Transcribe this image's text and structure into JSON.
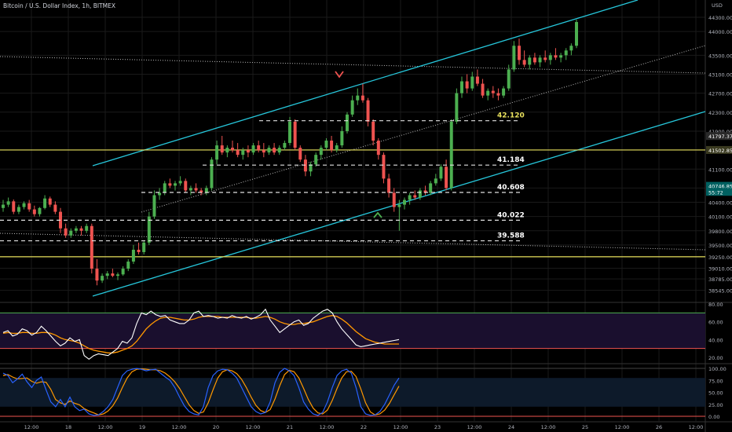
{
  "header": {
    "symbol_text": "Bitcoin / U.S. Dollar Index, 1h, BITMEX"
  },
  "colors": {
    "bg": "#000000",
    "grid": "#1a1a1a",
    "up": "#4caf50",
    "down": "#ef5350",
    "channel": "#26c6da",
    "yellow": "#e8e05c",
    "dashed": "#e0e0e0",
    "rsi_line": "#ffffff",
    "rsi_ma": "#ff9800",
    "rsi_band": "#1a0f2e",
    "rsi_upper": "#4caf50",
    "rsi_lower": "#ef5350",
    "stoch_k": "#2962ff",
    "stoch_d": "#ff9800",
    "stoch_band": "#0d1a2a",
    "last_price_bg": "#006060"
  },
  "chart_data": [
    {
      "type": "candlestick",
      "currency": "USD",
      "ylim": [
        38450,
        44400
      ],
      "y_ticks": [
        "44300.00",
        "44000.00",
        "43500.00",
        "43100.00",
        "42700.00",
        "42300.00",
        "41900.00",
        "41500.00",
        "41100.00",
        "40700.00",
        "40400.00",
        "40100.00",
        "39800.00",
        "39500.00",
        "39250.00",
        "39010.00",
        "38785.00",
        "38545.00"
      ],
      "x_ticks": [
        "12:00",
        "18",
        "12:00",
        "19",
        "12:00",
        "20",
        "12:00",
        "21",
        "12:00",
        "22",
        "12:00",
        "23",
        "12:00",
        "24",
        "12:00",
        "25",
        "12:00",
        "26",
        "12:00"
      ],
      "levels": [
        {
          "label": "42.120",
          "value": 42120,
          "style": "dashed",
          "label_color": "#e8e05c"
        },
        {
          "label": "41.184",
          "value": 41184,
          "style": "dashed",
          "label_color": "#ffffff"
        },
        {
          "label": "40.608",
          "value": 40608,
          "style": "dashed",
          "label_color": "#ffffff"
        },
        {
          "label": "40.022",
          "value": 40022,
          "style": "dashed",
          "label_color": "#ffffff"
        },
        {
          "label": "39.588",
          "value": 39588,
          "style": "dashed",
          "label_color": "#ffffff"
        }
      ],
      "horizontal_lines": [
        41502.85,
        39252
      ],
      "price_badges": [
        {
          "label": "41797.37",
          "value": 41797,
          "bg": "#2a2a2a"
        },
        {
          "label": "41502.85",
          "value": 41502.85,
          "bg": "#3a3a20"
        },
        {
          "label": "40746.85",
          "value": 40746.85,
          "bg": "#006060"
        },
        {
          "label": "55:72",
          "value": 40620,
          "bg": "#006060"
        }
      ],
      "candles": [
        [
          40280,
          40450,
          40200,
          40350
        ],
        [
          40350,
          40500,
          40300,
          40420
        ],
        [
          40420,
          40460,
          40150,
          40200
        ],
        [
          40200,
          40350,
          40150,
          40300
        ],
        [
          40300,
          40420,
          40250,
          40380
        ],
        [
          40380,
          40450,
          40200,
          40250
        ],
        [
          40250,
          40330,
          40100,
          40150
        ],
        [
          40150,
          40300,
          40100,
          40280
        ],
        [
          40280,
          40550,
          40250,
          40480
        ],
        [
          40480,
          40520,
          40300,
          40350
        ],
        [
          40350,
          40420,
          40150,
          40200
        ],
        [
          40200,
          40280,
          39750,
          39850
        ],
        [
          39850,
          39950,
          39650,
          39700
        ],
        [
          39700,
          39850,
          39650,
          39800
        ],
        [
          39800,
          39900,
          39750,
          39850
        ],
        [
          39850,
          39900,
          39700,
          39800
        ],
        [
          39800,
          39950,
          39750,
          39900
        ],
        [
          39900,
          39950,
          38900,
          39000
        ],
        [
          39000,
          39200,
          38650,
          38750
        ],
        [
          38750,
          38900,
          38700,
          38850
        ],
        [
          38850,
          38950,
          38780,
          38900
        ],
        [
          38900,
          39000,
          38820,
          38850
        ],
        [
          38850,
          38920,
          38760,
          38880
        ],
        [
          38880,
          39050,
          38850,
          39000
        ],
        [
          39000,
          39200,
          38950,
          39150
        ],
        [
          39150,
          39500,
          39100,
          39400
        ],
        [
          39400,
          39550,
          39300,
          39350
        ],
        [
          39350,
          39600,
          39300,
          39550
        ],
        [
          39550,
          40200,
          39500,
          40100
        ],
        [
          40100,
          40650,
          40050,
          40550
        ],
        [
          40550,
          40700,
          40450,
          40600
        ],
        [
          40600,
          40850,
          40550,
          40800
        ],
        [
          40800,
          40900,
          40700,
          40750
        ],
        [
          40750,
          40850,
          40650,
          40800
        ],
        [
          40800,
          40950,
          40750,
          40850
        ],
        [
          40850,
          40900,
          40600,
          40650
        ],
        [
          40650,
          40750,
          40550,
          40700
        ],
        [
          40700,
          40800,
          40600,
          40650
        ],
        [
          40650,
          40700,
          40550,
          40600
        ],
        [
          40600,
          40750,
          40550,
          40700
        ],
        [
          40700,
          41350,
          40650,
          41300
        ],
        [
          41300,
          41700,
          41200,
          41600
        ],
        [
          41600,
          41800,
          41400,
          41450
        ],
        [
          41450,
          41600,
          41350,
          41550
        ],
        [
          41550,
          41700,
          41450,
          41500
        ],
        [
          41500,
          41650,
          41350,
          41400
        ],
        [
          41400,
          41550,
          41300,
          41500
        ],
        [
          41500,
          41600,
          41350,
          41450
        ],
        [
          41450,
          41650,
          41400,
          41600
        ],
        [
          41600,
          41700,
          41450,
          41500
        ],
        [
          41500,
          41650,
          41350,
          41450
        ],
        [
          41450,
          41600,
          41400,
          41550
        ],
        [
          41550,
          41650,
          41400,
          41450
        ],
        [
          41450,
          41600,
          41400,
          41550
        ],
        [
          41550,
          41700,
          41500,
          41650
        ],
        [
          41650,
          42200,
          41600,
          42100
        ],
        [
          42100,
          42150,
          41500,
          41550
        ],
        [
          41550,
          41600,
          41250,
          41300
        ],
        [
          41300,
          41400,
          40950,
          41050
        ],
        [
          41050,
          41250,
          40950,
          41200
        ],
        [
          41200,
          41450,
          41150,
          41400
        ],
        [
          41400,
          41600,
          41300,
          41550
        ],
        [
          41550,
          41750,
          41500,
          41700
        ],
        [
          41700,
          41800,
          41450,
          41500
        ],
        [
          41500,
          41650,
          41450,
          41600
        ],
        [
          41600,
          42000,
          41550,
          41900
        ],
        [
          41900,
          42300,
          41850,
          42250
        ],
        [
          42250,
          42650,
          42200,
          42550
        ],
        [
          42550,
          42800,
          42450,
          42650
        ],
        [
          42650,
          42900,
          42500,
          42550
        ],
        [
          42550,
          42600,
          42000,
          42100
        ],
        [
          42100,
          42150,
          41600,
          41700
        ],
        [
          41700,
          41750,
          41300,
          41400
        ],
        [
          41400,
          41450,
          40800,
          40900
        ],
        [
          40900,
          41000,
          40500,
          40600
        ],
        [
          40600,
          40700,
          40200,
          40300
        ],
        [
          40300,
          40450,
          39800,
          40350
        ],
        [
          40350,
          40500,
          40250,
          40450
        ],
        [
          40450,
          40600,
          40350,
          40550
        ],
        [
          40550,
          40650,
          40450,
          40500
        ],
        [
          40500,
          40700,
          40450,
          40650
        ],
        [
          40650,
          40750,
          40550,
          40600
        ],
        [
          40600,
          40850,
          40550,
          40800
        ],
        [
          40800,
          41000,
          40750,
          40900
        ],
        [
          40900,
          41200,
          40850,
          41150
        ],
        [
          41150,
          41300,
          40650,
          40700
        ],
        [
          40700,
          42150,
          40650,
          42100
        ],
        [
          42100,
          42800,
          42050,
          42700
        ],
        [
          42700,
          43050,
          42600,
          42950
        ],
        [
          42950,
          43100,
          42700,
          42800
        ],
        [
          42800,
          43150,
          42750,
          43050
        ],
        [
          43050,
          43200,
          42850,
          42900
        ],
        [
          42900,
          43000,
          42600,
          42650
        ],
        [
          42650,
          42800,
          42550,
          42750
        ],
        [
          42750,
          42850,
          42600,
          42700
        ],
        [
          42700,
          42800,
          42550,
          42650
        ],
        [
          42650,
          42850,
          42600,
          42800
        ],
        [
          42800,
          43300,
          42750,
          43200
        ],
        [
          43200,
          43800,
          43150,
          43700
        ],
        [
          43700,
          43850,
          43300,
          43400
        ],
        [
          43400,
          43600,
          43250,
          43300
        ],
        [
          43300,
          43500,
          43200,
          43450
        ],
        [
          43450,
          43550,
          43300,
          43350
        ],
        [
          43350,
          43500,
          43250,
          43450
        ],
        [
          43450,
          43600,
          43350,
          43400
        ],
        [
          43400,
          43550,
          43300,
          43500
        ],
        [
          43500,
          43650,
          43400,
          43450
        ],
        [
          43450,
          43550,
          43350,
          43500
        ],
        [
          43500,
          43650,
          43400,
          43600
        ],
        [
          43600,
          43750,
          43500,
          43700
        ],
        [
          43700,
          44250,
          43650,
          44200
        ]
      ]
    },
    {
      "type": "line",
      "name": "RSI",
      "ylim": [
        15,
        85
      ],
      "y_ticks": [
        "80.00",
        "60.00",
        "40.00",
        "20.00"
      ],
      "bands": [
        70,
        30
      ],
      "series": [
        {
          "role": "rsi",
          "values": [
            48,
            50,
            44,
            46,
            52,
            50,
            45,
            48,
            55,
            50,
            44,
            38,
            33,
            36,
            42,
            38,
            40,
            22,
            18,
            22,
            24,
            23,
            22,
            26,
            30,
            38,
            36,
            42,
            58,
            70,
            68,
            72,
            68,
            66,
            67,
            62,
            60,
            58,
            58,
            62,
            70,
            72,
            66,
            67,
            66,
            64,
            65,
            64,
            67,
            65,
            64,
            66,
            63,
            65,
            68,
            74,
            62,
            55,
            48,
            52,
            56,
            60,
            62,
            56,
            58,
            64,
            68,
            72,
            74,
            70,
            60,
            52,
            46,
            40,
            34,
            32,
            33,
            34,
            35,
            36,
            37,
            38,
            39,
            40
          ]
        },
        {
          "role": "ma",
          "values": [
            47,
            48,
            47,
            47,
            48,
            48,
            47,
            47,
            48,
            48,
            47,
            45,
            42,
            40,
            39,
            38,
            36,
            33,
            30,
            28,
            27,
            26,
            25,
            25,
            26,
            28,
            30,
            33,
            38,
            45,
            52,
            57,
            61,
            64,
            65,
            65,
            64,
            63,
            62,
            62,
            63,
            65,
            66,
            66,
            66,
            66,
            65,
            65,
            65,
            65,
            65,
            65,
            64,
            64,
            65,
            66,
            65,
            63,
            60,
            58,
            57,
            57,
            58,
            58,
            59,
            60,
            62,
            64,
            66,
            67,
            66,
            63,
            59,
            54,
            49,
            45,
            41,
            39,
            37,
            36,
            35,
            35,
            35,
            35
          ]
        }
      ]
    },
    {
      "type": "line",
      "name": "Stoch",
      "ylim": [
        -5,
        105
      ],
      "y_ticks": [
        "100.00",
        "75.00",
        "50.00",
        "25.00",
        "0.00"
      ],
      "series": [
        {
          "role": "k",
          "values": [
            90,
            85,
            70,
            78,
            88,
            72,
            60,
            75,
            82,
            55,
            30,
            20,
            35,
            20,
            40,
            20,
            12,
            15,
            5,
            2,
            3,
            10,
            20,
            35,
            60,
            85,
            95,
            98,
            100,
            98,
            95,
            97,
            98,
            90,
            82,
            75,
            60,
            40,
            22,
            10,
            5,
            3,
            20,
            60,
            85,
            95,
            98,
            97,
            90,
            80,
            60,
            40,
            20,
            10,
            5,
            8,
            30,
            70,
            92,
            100,
            95,
            85,
            60,
            30,
            15,
            5,
            2,
            8,
            30,
            60,
            85,
            95,
            98,
            90,
            60,
            20,
            5,
            2,
            3,
            10,
            25,
            45,
            65,
            80
          ]
        },
        {
          "role": "d",
          "values": [
            85,
            87,
            82,
            78,
            79,
            80,
            73,
            69,
            72,
            71,
            56,
            35,
            28,
            25,
            32,
            27,
            24,
            16,
            11,
            7,
            3,
            5,
            11,
            22,
            38,
            60,
            80,
            93,
            98,
            99,
            98,
            97,
            97,
            95,
            90,
            82,
            72,
            58,
            41,
            24,
            12,
            6,
            9,
            28,
            55,
            80,
            93,
            97,
            95,
            89,
            77,
            60,
            40,
            23,
            12,
            8,
            14,
            36,
            64,
            87,
            96,
            93,
            80,
            58,
            35,
            17,
            7,
            5,
            13,
            33,
            58,
            80,
            93,
            94,
            83,
            57,
            28,
            9,
            3,
            5,
            13,
            27,
            45,
            63
          ]
        }
      ]
    }
  ]
}
